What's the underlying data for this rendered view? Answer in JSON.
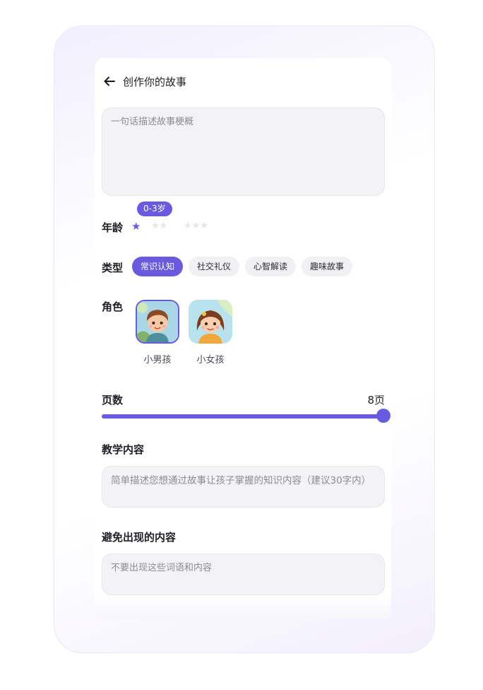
{
  "header": {
    "title": "创作你的故事",
    "back_icon": "arrow-left-icon"
  },
  "story_input": {
    "placeholder": "一句话描述故事梗概",
    "value": ""
  },
  "age": {
    "label": "年龄",
    "selected_badge": "0-3岁",
    "selected_index": 0,
    "options_star_counts": [
      1,
      2,
      3
    ]
  },
  "type": {
    "label": "类型",
    "chips": [
      {
        "label": "常识认知",
        "active": true
      },
      {
        "label": "社交礼仪",
        "active": false
      },
      {
        "label": "心智解读",
        "active": false
      },
      {
        "label": "趣味故事",
        "active": false
      }
    ]
  },
  "role": {
    "label": "角色",
    "options": [
      {
        "name": "小男孩",
        "selected": true
      },
      {
        "name": "小女孩",
        "selected": false
      }
    ]
  },
  "pages": {
    "label": "页数",
    "value_text": "8页",
    "value": 8,
    "fraction": 1.0
  },
  "teach": {
    "label": "教学内容",
    "placeholder": "简单描述您想通过故事让孩子掌握的知识内容（建议30字内）"
  },
  "avoid": {
    "label": "避免出现的内容",
    "placeholder": "不要出现这些词语和内容"
  },
  "colors": {
    "accent": "#6a5ae0",
    "input_bg": "#f3f3f6",
    "chip_bg": "#f1f1f4"
  }
}
